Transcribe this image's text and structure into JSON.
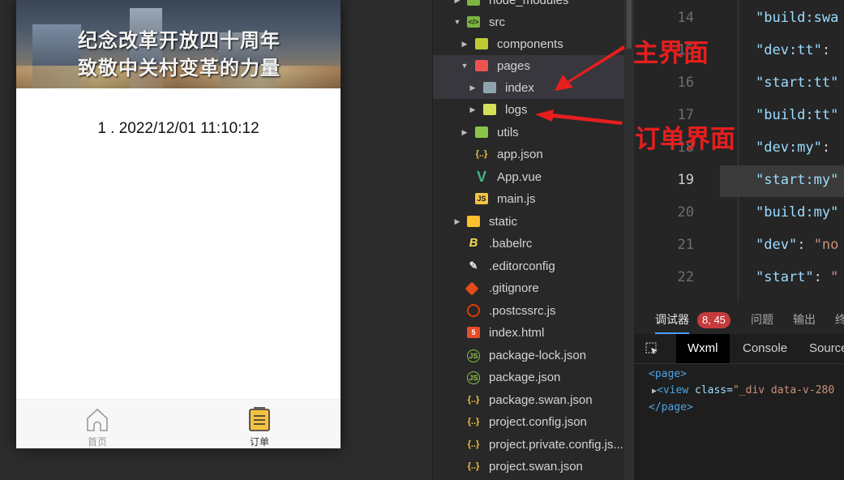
{
  "phone": {
    "banner_line1": "纪念改革开放四十周年",
    "banner_line2": "致敬中关村变革的力量",
    "order_line": "1 . 2022/12/01 11:10:12",
    "tabbar": {
      "home_label": "首页",
      "orders_label": "订单"
    }
  },
  "tree": {
    "items": [
      {
        "label": "node_modules",
        "icon": "folder-icon"
      },
      {
        "label": "src",
        "icon": "folder-code-icon"
      },
      {
        "label": "components",
        "icon": "folder-icon"
      },
      {
        "label": "pages",
        "icon": "folder-red-icon"
      },
      {
        "label": "index",
        "icon": "folder-icon"
      },
      {
        "label": "logs",
        "icon": "folder-icon"
      },
      {
        "label": "utils",
        "icon": "folder-icon"
      },
      {
        "label": "app.json",
        "icon": "json-icon"
      },
      {
        "label": "App.vue",
        "icon": "vue-icon"
      },
      {
        "label": "main.js",
        "icon": "js-icon"
      },
      {
        "label": "static",
        "icon": "folder-icon"
      },
      {
        "label": ".babelrc",
        "icon": "babel-icon"
      },
      {
        "label": ".editorconfig",
        "icon": "editorconfig-icon"
      },
      {
        "label": ".gitignore",
        "icon": "git-icon"
      },
      {
        "label": ".postcssrc.js",
        "icon": "postcss-icon"
      },
      {
        "label": "index.html",
        "icon": "html5-icon"
      },
      {
        "label": "package-lock.json",
        "icon": "node-icon"
      },
      {
        "label": "package.json",
        "icon": "node-icon"
      },
      {
        "label": "package.swan.json",
        "icon": "json-icon"
      },
      {
        "label": "project.config.json",
        "icon": "json-icon"
      },
      {
        "label": "project.private.config.js...",
        "icon": "json-icon"
      },
      {
        "label": "project.swan.json",
        "icon": "json-icon"
      }
    ]
  },
  "editor": {
    "line_numbers": [
      "14",
      "15",
      "16",
      "17",
      "18",
      "19",
      "20",
      "21",
      "22"
    ],
    "current_line": "19",
    "lines": [
      {
        "key": "\"build:swa",
        "colon": "",
        "value": ""
      },
      {
        "key": "\"dev:tt\"",
        "colon": ":",
        "value": ""
      },
      {
        "key": "\"start:tt\"",
        "colon": "",
        "value": ""
      },
      {
        "key": "\"build:tt\"",
        "colon": "",
        "value": ""
      },
      {
        "key": "\"dev:my\"",
        "colon": ":",
        "value": ""
      },
      {
        "key": "\"start:my\"",
        "colon": "",
        "value": ""
      },
      {
        "key": "\"build:my\"",
        "colon": "",
        "value": ""
      },
      {
        "key": "\"dev\"",
        "colon": ":",
        "value": "\"no"
      },
      {
        "key": "\"start\"",
        "colon": ":",
        "value": "\""
      }
    ]
  },
  "devtools": {
    "tabs": [
      "调试器",
      "问题",
      "输出",
      "终"
    ],
    "badge": "8, 45",
    "subtabs": [
      "Wxml",
      "Console",
      "Source"
    ],
    "xml_line1": "<page>",
    "xml_line2_tag": "<view",
    "xml_line2_attr": " class=",
    "xml_line2_val": "\"_div data-v-280",
    "xml_line3": "</page>"
  },
  "annotations": {
    "main": "主界面",
    "orders": "订单界面"
  },
  "colors": {
    "annotation_red": "#e61e1e",
    "tab_active": "#333333",
    "tab_inactive": "#9a9a9a"
  }
}
